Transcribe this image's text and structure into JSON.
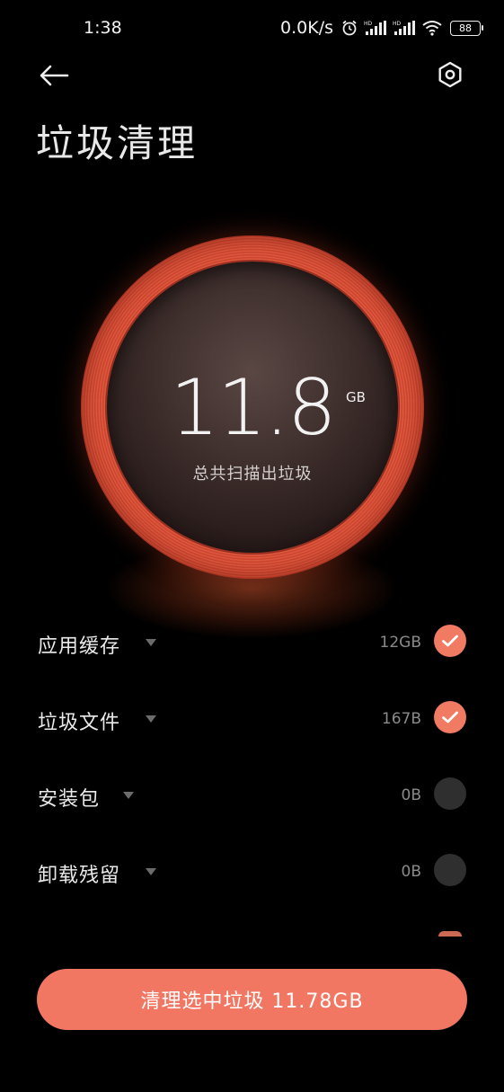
{
  "status_bar": {
    "time": "1:38",
    "net_speed": "0.0K/s",
    "battery": "88",
    "icons": [
      "alarm-icon",
      "hd-signal-icon",
      "hd-signal-icon",
      "wifi-icon",
      "battery-icon"
    ]
  },
  "header": {
    "title": "垃圾清理",
    "back_icon": "arrow-left-icon",
    "settings_icon": "hexagon-settings-icon"
  },
  "summary": {
    "total_value": "11.8",
    "unit": "GB",
    "label": "总共扫描出垃圾"
  },
  "categories": [
    {
      "name": "应用缓存",
      "size": "12GB",
      "selected": true
    },
    {
      "name": "垃圾文件",
      "size": "167B",
      "selected": true
    },
    {
      "name": "安装包",
      "size": "0B",
      "selected": false
    },
    {
      "name": "卸载残留",
      "size": "0B",
      "selected": false
    }
  ],
  "clean_button": {
    "label": "清理选中垃圾 11.78GB"
  },
  "colors": {
    "accent": "#f27763",
    "background": "#000000",
    "unchecked": "#2f2f2f"
  }
}
